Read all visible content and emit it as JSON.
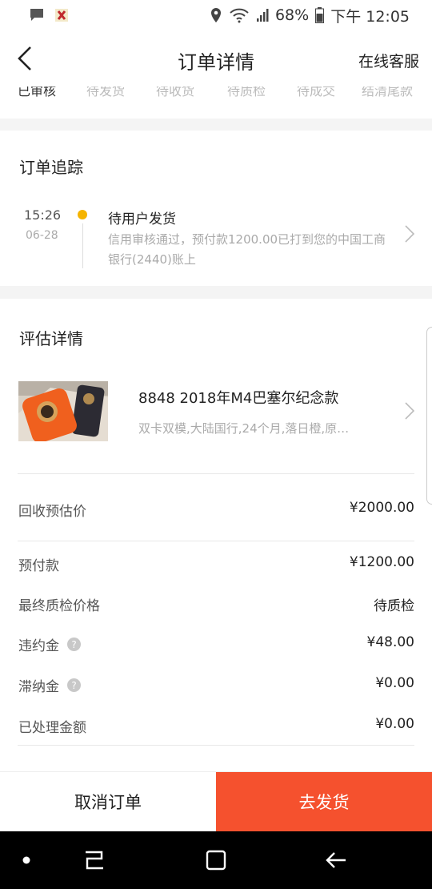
{
  "status_bar": {
    "battery": "68%",
    "time": "下午 12:05",
    "icons": [
      "message-icon",
      "app-notification-icon",
      "location-icon",
      "wifi-icon",
      "signal-icon",
      "battery-icon"
    ]
  },
  "nav": {
    "title": "订单详情",
    "right_link": "在线客服",
    "back_icon": "chevron-left-icon"
  },
  "steps": [
    "已审核",
    "待发货",
    "待收货",
    "待质检",
    "待成交",
    "结清尾款"
  ],
  "tracking": {
    "section_title": "订单追踪",
    "time": "15:26",
    "date": "06-28",
    "status_title": "待用户发货",
    "status_desc": "信用审核通过，预付款1200.00已打到您的中国工商银行(2440)账上"
  },
  "evaluation": {
    "section_title": "评估详情",
    "product_name": "8848 2018年M4巴塞尔纪念款",
    "product_spec": "双卡双模,大陆国行,24个月,落日橙,原…",
    "rows": [
      {
        "label": "回收预估价",
        "value": "¥2000.00"
      },
      {
        "label": "预付款",
        "value": "¥1200.00"
      },
      {
        "label": "最终质检价格",
        "value": "待质检"
      },
      {
        "label": "违约金",
        "value": "¥48.00"
      },
      {
        "label": "滞纳金",
        "value": "¥0.00"
      },
      {
        "label": "已处理金额",
        "value": "¥0.00"
      }
    ]
  },
  "bottom": {
    "cancel_label": "取消订单",
    "ship_label": "去发货"
  },
  "colors": {
    "accent": "#f5512e",
    "dot": "#f5b400"
  }
}
